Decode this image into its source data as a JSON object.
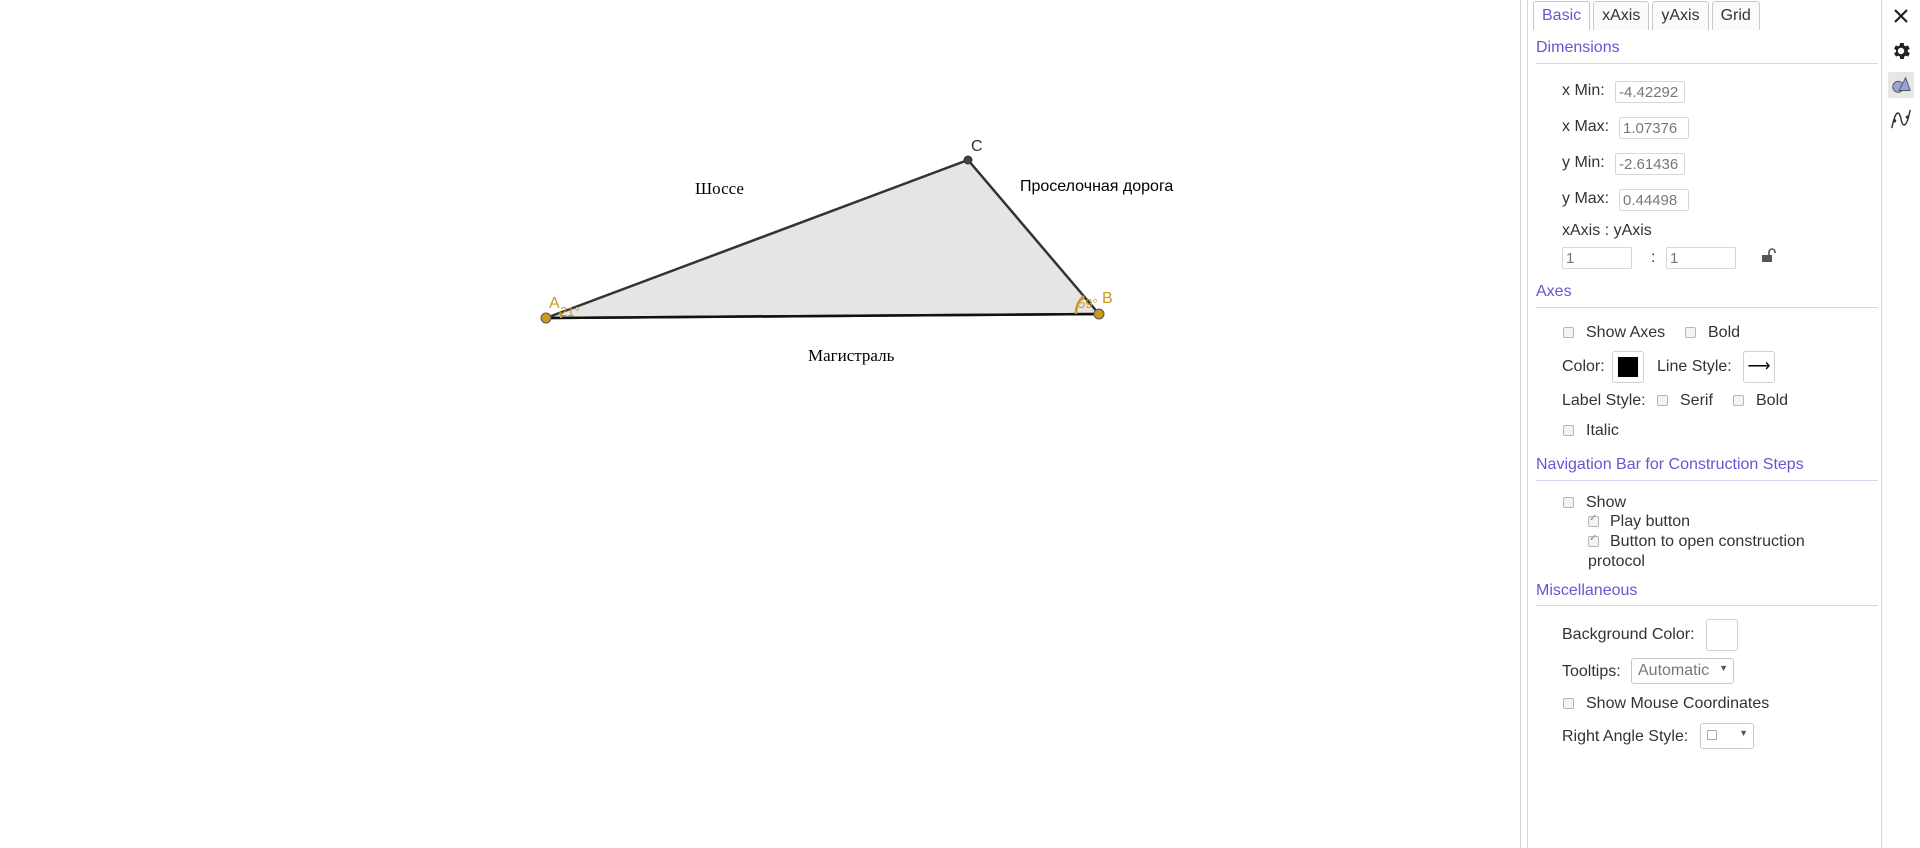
{
  "graphics": {
    "points": [
      {
        "name": "A",
        "color": "#c89b1f"
      },
      {
        "name": "B",
        "color": "#c89b1f"
      },
      {
        "name": "C",
        "color": "#333333"
      }
    ],
    "angle_A": "21°",
    "angle_B": "59°",
    "texts": {
      "highway": "Шоссе",
      "dirt_road": "Проселочная дорога",
      "main_road": "Магистраль"
    },
    "fill_color": "#e5e5e5",
    "stroke_color": "#333333",
    "angle_color": "#c89b1f"
  },
  "tabs": [
    {
      "label": "Basic",
      "active": true
    },
    {
      "label": "xAxis",
      "active": false
    },
    {
      "label": "yAxis",
      "active": false
    },
    {
      "label": "Grid",
      "active": false
    }
  ],
  "dimensions": {
    "title": "Dimensions",
    "xmin_label": "x Min:",
    "xmin": "-4.42292",
    "xmax_label": "x Max:",
    "xmax": "1.07376",
    "ymin_label": "y Min:",
    "ymin": "-2.61436",
    "ymax_label": "y Max:",
    "ymax": "0.44498",
    "ratio_label": "xAxis : yAxis",
    "ratio_x": "1",
    "ratio_sep": ":",
    "ratio_y": "1"
  },
  "axes": {
    "title": "Axes",
    "show_axes": "Show Axes",
    "show_axes_checked": false,
    "bold": "Bold",
    "bold_checked": false,
    "color_label": "Color:",
    "axis_color": "#000000",
    "line_style_label": "Line Style:",
    "line_style_value": "⟶",
    "label_style": "Label Style:",
    "serif": "Serif",
    "label_bold": "Bold",
    "italic": "Italic"
  },
  "navbar": {
    "title": "Navigation Bar for Construction Steps",
    "show": "Show",
    "play_button": "Play button",
    "play_checked": true,
    "open_protocol": "Button to open construction",
    "open_protocol_2": "protocol",
    "open_protocol_checked": true
  },
  "misc": {
    "title": "Miscellaneous",
    "bg_color_label": "Background Color:",
    "bg_color": "#ffffff",
    "tooltips_label": "Tooltips:",
    "tooltips_value": "Automatic",
    "mouse_coords": "Show Mouse Coordinates",
    "right_angle_label": "Right Angle Style:",
    "right_angle_value": "□"
  },
  "sidebar_icons": [
    "close-icon",
    "gear-icon",
    "graphics-icon",
    "algebra-icon"
  ]
}
